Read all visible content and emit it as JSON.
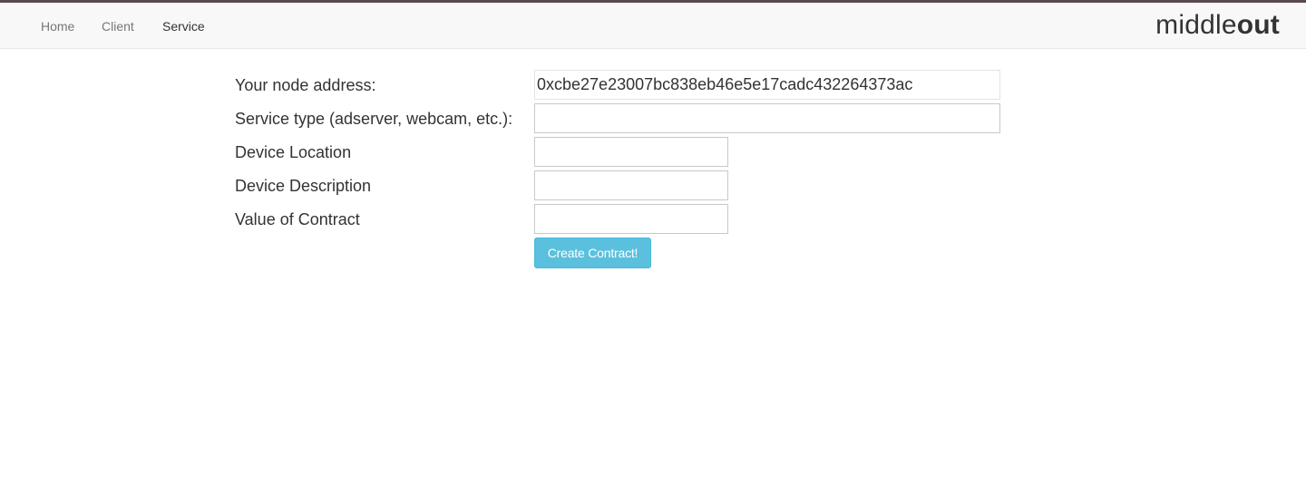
{
  "nav": {
    "items": [
      {
        "label": "Home",
        "active": false
      },
      {
        "label": "Client",
        "active": false
      },
      {
        "label": "Service",
        "active": true
      }
    ],
    "brand_regular": "middle",
    "brand_bold": "out"
  },
  "form": {
    "node_address": {
      "label": "Your node address:",
      "value": "0xcbe27e23007bc838eb46e5e17cadc432264373ac"
    },
    "service_type": {
      "label": "Service type (adserver, webcam, etc.):",
      "value": ""
    },
    "device_location": {
      "label": "Device Location",
      "value": ""
    },
    "device_description": {
      "label": "Device Description",
      "value": ""
    },
    "contract_value": {
      "label": "Value of Contract",
      "value": ""
    },
    "submit_label": "Create Contract!"
  },
  "colors": {
    "button": "#5bc0de",
    "navbar_bg": "#f8f8f8",
    "top_line": "#5a4a4e"
  }
}
